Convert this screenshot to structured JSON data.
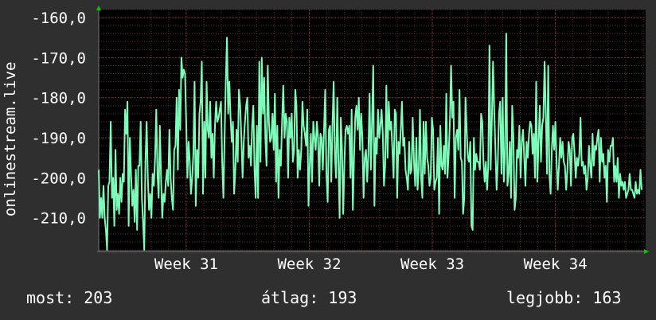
{
  "chart_data": {
    "type": "line",
    "ylabel": "onlinestream.live",
    "ylim": [
      -218,
      -158
    ],
    "yticks": [
      -160,
      -170,
      -180,
      -190,
      -200,
      -210
    ],
    "ytick_labels": [
      "-160,0",
      "-170,0",
      "-180,0",
      "-190,0",
      "-200,0",
      "-210,0"
    ],
    "xlim": [
      0,
      100
    ],
    "xticks": [
      {
        "x": 16,
        "label": "Week 31"
      },
      {
        "x": 38.5,
        "label": "Week 32"
      },
      {
        "x": 61,
        "label": "Week 33"
      },
      {
        "x": 83.5,
        "label": "Week 34"
      }
    ],
    "colors": {
      "line": "#7dfcb9",
      "background": "#000000",
      "grid": "#5a2626",
      "page": "#2f2f2f",
      "axis_arrow": "#00cc00"
    },
    "series": [
      {
        "values": [
          -198,
          -210,
          -205,
          -210,
          -202,
          -210,
          -213,
          -218,
          -202,
          -201,
          -186,
          -205,
          -200,
          -212,
          -193,
          -208,
          -204,
          -209,
          -200,
          -206,
          -199,
          -201,
          -183,
          -189,
          -181,
          -212,
          -190,
          -199,
          -207,
          -203,
          -211,
          -198,
          -213,
          -197,
          -197,
          -186,
          -205,
          -211,
          -218,
          -196,
          -186,
          -200,
          -208,
          -204,
          -210,
          -199,
          -202,
          -195,
          -183,
          -199,
          -205,
          -187,
          -200,
          -210,
          -204,
          -206,
          -201,
          -198,
          -202,
          -188,
          -200,
          -205,
          -208,
          -193,
          -192,
          -180,
          -198,
          -178,
          -188,
          -170,
          -175,
          -173,
          -174,
          -186,
          -200,
          -191,
          -196,
          -204,
          -200,
          -194,
          -176,
          -207,
          -193,
          -200,
          -184,
          -181,
          -171,
          -204,
          -186,
          -200,
          -176,
          -188,
          -190,
          -181,
          -195,
          -189,
          -200,
          -187,
          -181,
          -186,
          -185,
          -183,
          -181,
          -196,
          -205,
          -190,
          -176,
          -165,
          -184,
          -176,
          -185,
          -191,
          -186,
          -204,
          -198,
          -188,
          -196,
          -178,
          -182,
          -190,
          -200,
          -191,
          -186,
          -182,
          -180,
          -195,
          -192,
          -197,
          -187,
          -182,
          -198,
          -205,
          -187,
          -205,
          -171,
          -196,
          -170,
          -184,
          -175,
          -190,
          -197,
          -172,
          -186,
          -191,
          -190,
          -184,
          -193,
          -179,
          -201,
          -187,
          -205,
          -193,
          -197,
          -186,
          -177,
          -190,
          -184,
          -186,
          -200,
          -185,
          -190,
          -184,
          -196,
          -193,
          -178,
          -182,
          -200,
          -193,
          -198,
          -193,
          -181,
          -187,
          -189,
          -192,
          -183,
          -207,
          -197,
          -189,
          -201,
          -186,
          -190,
          -193,
          -186,
          -190,
          -202,
          -189,
          -190,
          -198,
          -188,
          -178,
          -199,
          -206,
          -188,
          -187,
          -201,
          -187,
          -176,
          -194,
          -200,
          -180,
          -196,
          -210,
          -185,
          -193,
          -209,
          -196,
          -188,
          -187,
          -189,
          -187,
          -200,
          -183,
          -208,
          -195,
          -185,
          -182,
          -188,
          -180,
          -193,
          -184,
          -190,
          -205,
          -195,
          -193,
          -201,
          -194,
          -179,
          -198,
          -186,
          -172,
          -207,
          -190,
          -194,
          -183,
          -190,
          -187,
          -183,
          -189,
          -202,
          -197,
          -177,
          -195,
          -181,
          -188,
          -186,
          -193,
          -200,
          -183,
          -184,
          -205,
          -191,
          -194,
          -188,
          -181,
          -192,
          -190,
          -198,
          -200,
          -203,
          -191,
          -199,
          -198,
          -185,
          -196,
          -202,
          -190,
          -203,
          -198,
          -183,
          -200,
          -205,
          -186,
          -199,
          -186,
          -195,
          -197,
          -202,
          -200,
          -185,
          -188,
          -203,
          -201,
          -200,
          -190,
          -209,
          -187,
          -197,
          -198,
          -192,
          -199,
          -179,
          -200,
          -194,
          -186,
          -172,
          -185,
          -181,
          -205,
          -190,
          -188,
          -193,
          -178,
          -195,
          -196,
          -209,
          -205,
          -180,
          -188,
          -195,
          -196,
          -191,
          -212,
          -213,
          -190,
          -198,
          -194,
          -196,
          -196,
          -198,
          -184,
          -186,
          -196,
          -201,
          -196,
          -203,
          -197,
          -167,
          -198,
          -186,
          -171,
          -183,
          -193,
          -203,
          -196,
          -184,
          -181,
          -199,
          -180,
          -201,
          -194,
          -164,
          -202,
          -199,
          -191,
          -205,
          -182,
          -190,
          -208,
          -205,
          -193,
          -195,
          -187,
          -200,
          -191,
          -188,
          -195,
          -202,
          -191,
          -195,
          -189,
          -186,
          -187,
          -194,
          -189,
          -200,
          -176,
          -201,
          -191,
          -182,
          -196,
          -187,
          -185,
          -171,
          -184,
          -199,
          -172,
          -199,
          -204,
          -193,
          -187,
          -193,
          -186,
          -196,
          -203,
          -197,
          -190,
          -195,
          -191,
          -196,
          -197,
          -203,
          -198,
          -191,
          -193,
          -202,
          -190,
          -189,
          -194,
          -200,
          -195,
          -197,
          -194,
          -185,
          -197,
          -196,
          -199,
          -197,
          -203,
          -200,
          -192,
          -197,
          -200,
          -189,
          -197,
          -192,
          -193,
          -190,
          -188,
          -201,
          -190,
          -196,
          -194,
          -200,
          -197,
          -206,
          -193,
          -196,
          -192,
          -192,
          -190,
          -201,
          -197,
          -201,
          -195,
          -205,
          -199,
          -202,
          -201,
          -203,
          -201,
          -205,
          -204,
          -203,
          -199,
          -203,
          -203,
          -204,
          -205,
          -201,
          -204,
          -203,
          -204,
          -198,
          -203
        ]
      }
    ]
  },
  "stats": {
    "now": "most: 203",
    "avg": "átlag: 193",
    "best": "legjobb: 163"
  }
}
